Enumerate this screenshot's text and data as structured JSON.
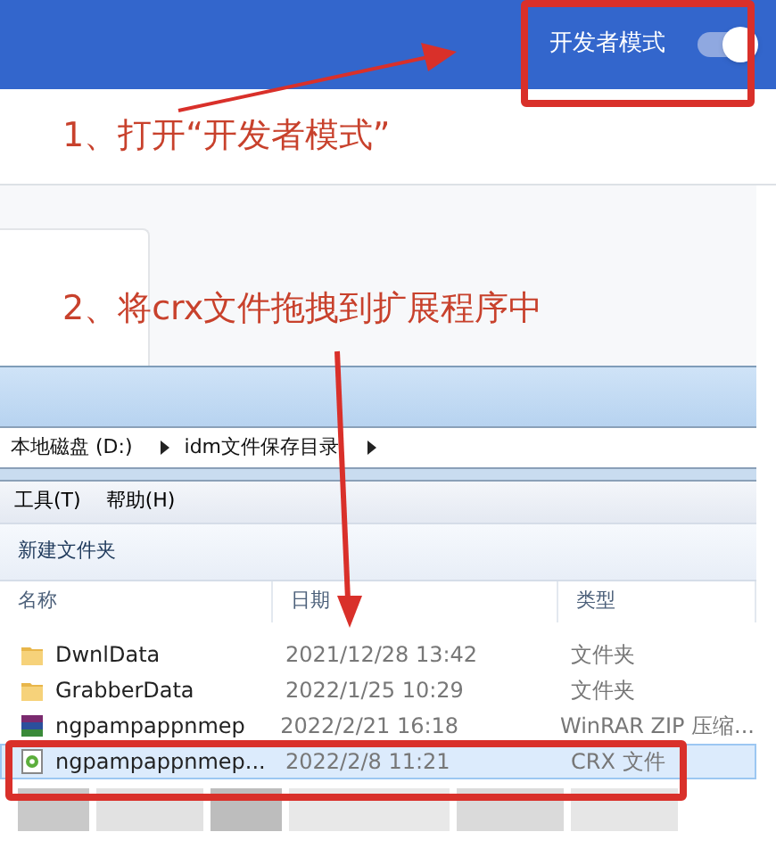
{
  "header": {
    "dev_mode": {
      "label": "开发者模式",
      "on": true
    }
  },
  "annotations": [
    {
      "text": "1、打开“开发者模式”"
    },
    {
      "text": "2、将crx文件拖拽到扩展程序中"
    }
  ],
  "explorer": {
    "breadcrumb": [
      "本地磁盘 (D:)",
      "idm文件保存目录"
    ],
    "menu": [
      "工具(T)",
      "帮助(H)"
    ],
    "toolbar": [
      "新建文件夹"
    ],
    "columns": [
      "名称",
      "日期",
      "类型"
    ],
    "rows": [
      {
        "kind": "folder",
        "name": "DwnlData",
        "date": "2021/12/28 13:42",
        "type": "文件夹",
        "selected": false
      },
      {
        "kind": "folder",
        "name": "GrabberData",
        "date": "2022/1/25 10:29",
        "type": "文件夹",
        "selected": false
      },
      {
        "kind": "archive",
        "name": "ngpampappnmep",
        "date": "2022/2/21 16:18",
        "type": "WinRAR ZIP 压缩...",
        "selected": false
      },
      {
        "kind": "crx",
        "name": "ngpampappnmep...",
        "date": "2022/2/8 11:21",
        "type": "CRX 文件",
        "selected": true
      }
    ]
  }
}
